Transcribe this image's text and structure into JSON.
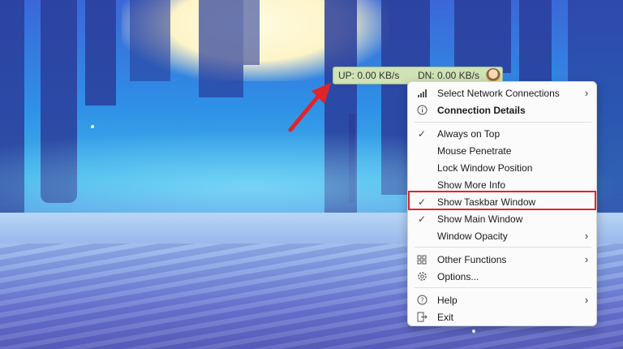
{
  "widget": {
    "up": "UP: 0.00 KB/s",
    "dn": "DN: 0.00 KB/s"
  },
  "menu": {
    "items": [
      {
        "label": "Select Network Connections",
        "icon": "signal-bars-icon",
        "submenu": true
      },
      {
        "label": "Connection Details",
        "icon": "info-icon",
        "bold": true
      },
      {
        "label": "Always on Top",
        "checked": true
      },
      {
        "label": "Mouse Penetrate"
      },
      {
        "label": "Lock Window Position"
      },
      {
        "label": "Show More Info"
      },
      {
        "label": "Show Taskbar Window",
        "checked": true,
        "highlighted": true
      },
      {
        "label": "Show Main Window",
        "checked": true
      },
      {
        "label": "Window Opacity",
        "submenu": true
      },
      {
        "label": "Other Functions",
        "icon": "grid-icon",
        "submenu": true
      },
      {
        "label": "Options...",
        "icon": "gear-icon"
      },
      {
        "label": "Help",
        "icon": "question-icon",
        "submenu": true
      },
      {
        "label": "Exit",
        "icon": "exit-icon"
      }
    ]
  },
  "colors": {
    "highlight_border": "#e0242b",
    "arrow": "#e0242b",
    "widget_bg": "#cfe3b4"
  }
}
